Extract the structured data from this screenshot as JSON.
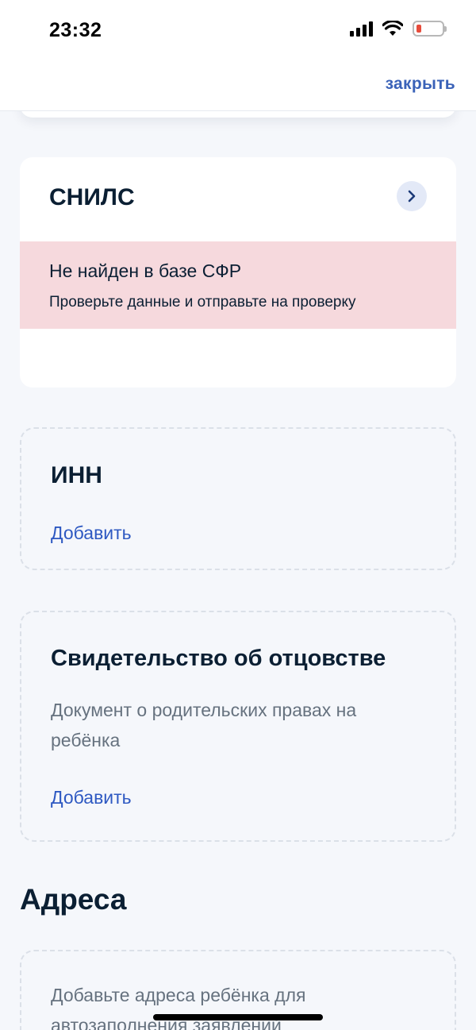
{
  "status": {
    "time": "23:32",
    "battery_color": "#e74c3c"
  },
  "header": {
    "close_label": "закрыть"
  },
  "snils": {
    "title": "СНИЛС",
    "error_title": "Не найден в базе СФР",
    "error_text": "Проверьте данные и отправьте на проверку"
  },
  "inn": {
    "title": "ИНН",
    "add_label": "Добавить"
  },
  "paternity": {
    "title": "Свидетельство об отцовстве",
    "description": "Документ о родительских правах на ребёнка",
    "add_label": "Добавить"
  },
  "addresses": {
    "section_title": "Адреса",
    "description": "Добавьте адреса ребёнка для автозаполнения заявлений"
  },
  "colors": {
    "accent": "#2e59c2",
    "error_bg": "#f6d9dd",
    "text": "#0b1f33"
  }
}
